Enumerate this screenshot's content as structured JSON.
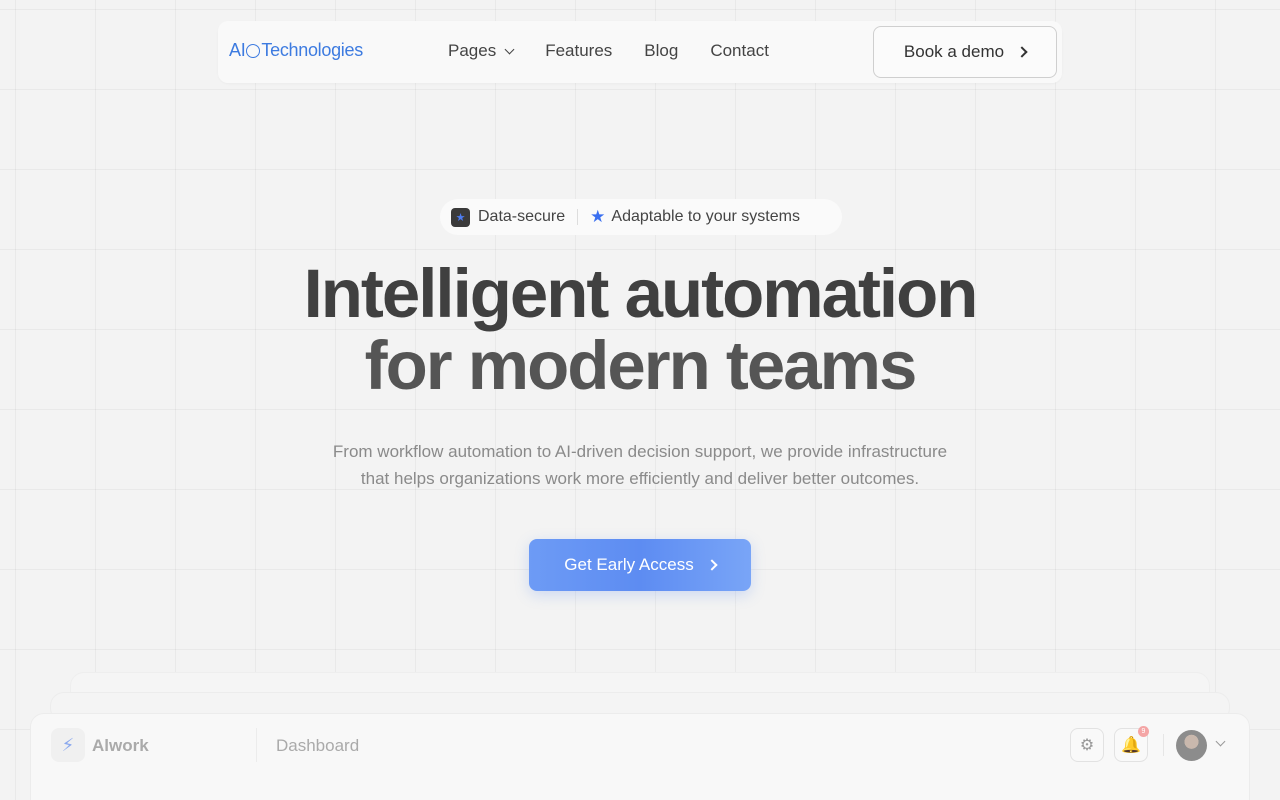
{
  "brand": {
    "name_pre": "AI",
    "name_post": "Technologies"
  },
  "nav": {
    "items": [
      {
        "label": "Pages",
        "has_dropdown": true
      },
      {
        "label": "Features"
      },
      {
        "label": "Blog"
      },
      {
        "label": "Contact"
      }
    ],
    "cta_label": "Book a demo"
  },
  "badge": {
    "item1": "Data-secure",
    "item2": "Adaptable to your systems",
    "icon1": "star-square-icon",
    "icon2": "star-icon"
  },
  "hero": {
    "title_line1": "Intelligent automation",
    "title_line2": "for modern teams",
    "subtitle_line1": "From workflow automation to AI-driven decision support, we provide infrastructure",
    "subtitle_line2": "that helps organizations work more efficiently and deliver better outcomes.",
    "cta_label": "Get Early Access"
  },
  "dashboard_preview": {
    "app_name": "Alwork",
    "page_title": "Dashboard",
    "notification_count": "9",
    "icons": [
      "lightning-icon",
      "gear-icon",
      "bell-icon",
      "avatar",
      "chevron-down-icon"
    ]
  },
  "colors": {
    "accent": "#3d7be0",
    "cta_gradient_start": "#6d9bf5",
    "background": "#f3f3f3"
  }
}
